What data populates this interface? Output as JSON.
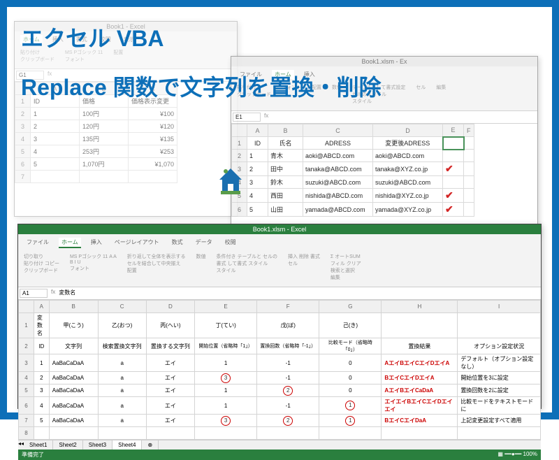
{
  "title": "エクセル VBA",
  "subtitle": "Replace 関数で文字列を置換・削除",
  "win1": {
    "title": "Book1 - Excel",
    "tabs": [
      "ホーム",
      "挿入",
      "書式",
      "校閲",
      "表示"
    ],
    "cellref": "G1",
    "headers": [
      "ID",
      "価格",
      "価格表示変更"
    ],
    "rows": [
      [
        "1",
        "100円",
        "¥100"
      ],
      [
        "2",
        "120円",
        "¥120"
      ],
      [
        "3",
        "135円",
        "¥135"
      ],
      [
        "4",
        "253円",
        "¥253"
      ],
      [
        "5",
        "1,070円",
        "¥1,070"
      ]
    ]
  },
  "win2": {
    "title": "Book1.xlsm - Ex",
    "cellref": "E1",
    "cols": [
      "A",
      "B",
      "C",
      "D",
      "E",
      "F"
    ],
    "headers": [
      "ID",
      "氏名",
      "ADRESS",
      "変更後ADRESS"
    ],
    "rows": [
      [
        "1",
        "青木",
        "aoki@ABCD.com",
        "aoki@ABCD.com"
      ],
      [
        "2",
        "田中",
        "tanaka@ABCD.com",
        "tanaka@XYZ.co.jp"
      ],
      [
        "3",
        "鈴木",
        "suzuki@ABCD.com",
        "suzuki@ABCD.com"
      ],
      [
        "4",
        "西田",
        "nishida@ABCD.com",
        "nishida@XYZ.co.jp"
      ],
      [
        "5",
        "山田",
        "yamada@ABCD.com",
        "yamada@XYZ.co.jp"
      ]
    ]
  },
  "win3": {
    "title": "Book1.xlsm - Excel",
    "tabs": [
      "ファイル",
      "ホーム",
      "挿入",
      "ページレイアウト",
      "数式",
      "データ",
      "校閲"
    ],
    "cellref": "A1",
    "formula": "変数名",
    "var_label": "変数名",
    "hcols": [
      "A",
      "B",
      "C",
      "D",
      "E",
      "F",
      "G",
      "H",
      "I"
    ],
    "headers1": [
      "甲(こう)",
      "乙(おつ)",
      "丙(へい)",
      "丁(てい)",
      "戊(ぼ)",
      "己(き)",
      "",
      ""
    ],
    "headers2": [
      "ID",
      "文字列",
      "検索置換文字列",
      "置換する文字列",
      "開始位置（省略時「1」）",
      "置換回数（省略時「-1」）",
      "比較モード（省略時「0」）",
      "置換結果",
      "オプション設定状況"
    ],
    "rows": [
      {
        "id": "1",
        "str": "AaBaCaDaA",
        "find": "a",
        "repl": "エイ",
        "start": "1",
        "count": "-1",
        "mode": "0",
        "result": "AエイBエイCエイDエイA",
        "opt": "デフォルト（オプション設定なし）"
      },
      {
        "id": "2",
        "str": "AaBaCaDaA",
        "find": "a",
        "repl": "エイ",
        "start": "3",
        "count": "-1",
        "mode": "0",
        "result": "BエイCエイDエイA",
        "opt": "開始位置を3に設定",
        "circ": "start"
      },
      {
        "id": "3",
        "str": "AaBaCaDaA",
        "find": "a",
        "repl": "エイ",
        "start": "1",
        "count": "2",
        "mode": "0",
        "result": "AエイBエイCaDaA",
        "opt": "置換回数を2に設定",
        "circ": "count"
      },
      {
        "id": "4",
        "str": "AaBaCaDaA",
        "find": "a",
        "repl": "エイ",
        "start": "1",
        "count": "-1",
        "mode": "1",
        "result": "エイエイBエイCエイDエイエイ",
        "opt": "比較モードをテキストモードに",
        "circ": "mode"
      },
      {
        "id": "5",
        "str": "AaBaCaDaA",
        "find": "a",
        "repl": "エイ",
        "start": "3",
        "count": "2",
        "mode": "1",
        "result": "BエイCエイDaA",
        "opt": "上記変更設定すべて適用",
        "circ": "all"
      }
    ],
    "sheets": [
      "Sheet1",
      "Sheet2",
      "Sheet3",
      "Sheet4"
    ],
    "status": "準備完了",
    "zoom": "100%"
  }
}
